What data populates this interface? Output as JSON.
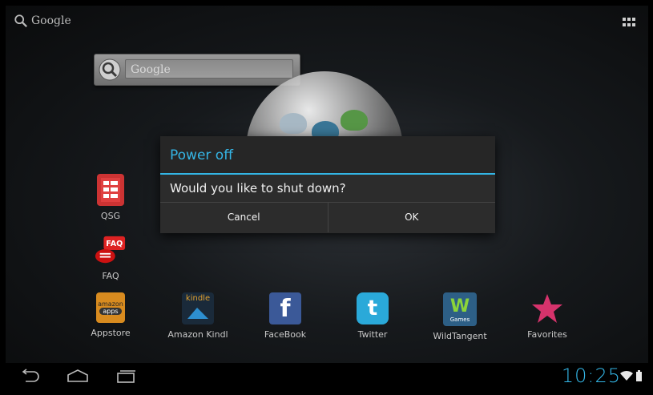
{
  "top_search": {
    "label": "Google"
  },
  "search_widget": {
    "placeholder": "Google"
  },
  "dialog": {
    "title": "Power off",
    "message": "Would you like to shut down?",
    "cancel_label": "Cancel",
    "ok_label": "OK"
  },
  "shortcuts": {
    "qsg": "QSG",
    "faq": "FAQ",
    "appstore": "Appstore",
    "amazon_kindle": "Amazon Kindl",
    "facebook": "FaceBook",
    "twitter": "Twitter",
    "wildtangent": "WildTangent",
    "favorites": "Favorites"
  },
  "icon_text": {
    "faq": "FAQ",
    "amazon": "amazon",
    "apps": "apps",
    "kindle": "kindle",
    "games": "Games"
  },
  "status": {
    "time": "10:25"
  },
  "colors": {
    "accent": "#33b5e5",
    "dialog_bg": "#2c2c2c"
  }
}
